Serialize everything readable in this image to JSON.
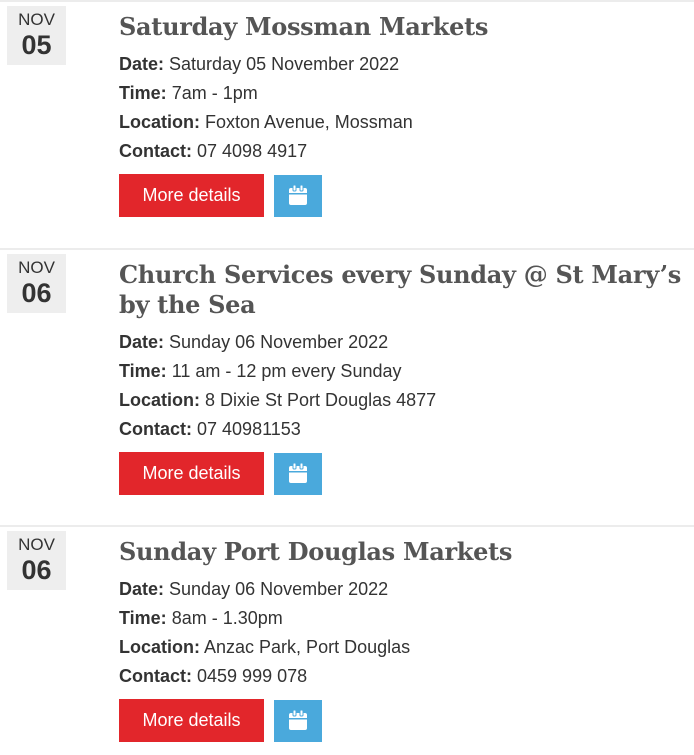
{
  "events": [
    {
      "month": "NOV",
      "day": "05",
      "title": "Saturday Mossman Markets",
      "date_label": "Date:",
      "date": "Saturday 05 November 2022",
      "time_label": "Time:",
      "time": "7am - 1pm",
      "location_label": "Location:",
      "location": "Foxton Avenue, Mossman",
      "contact_label": "Contact:",
      "contact": "07 4098 4917",
      "more_label": "More details",
      "calendar_icon": "calendar-icon"
    },
    {
      "month": "NOV",
      "day": "06",
      "title": "Church Services every Sunday @ St Mary’s by the Sea",
      "date_label": "Date:",
      "date": "Sunday 06 November 2022",
      "time_label": "Time:",
      "time": "11 am - 12 pm every Sunday",
      "location_label": "Location:",
      "location": "8 Dixie St Port Douglas 4877",
      "contact_label": "Contact:",
      "contact": "07 40981153",
      "more_label": "More details",
      "calendar_icon": "calendar-icon"
    },
    {
      "month": "NOV",
      "day": "06",
      "title": "Sunday Port Douglas Markets",
      "date_label": "Date:",
      "date": "Sunday 06 November 2022",
      "time_label": "Time:",
      "time": "8am - 1.30pm",
      "location_label": "Location:",
      "location": "Anzac Park, Port Douglas",
      "contact_label": "Contact:",
      "contact": "0459 999 078",
      "more_label": "More details",
      "calendar_icon": "calendar-icon"
    }
  ],
  "colors": {
    "more_button": "#e2262b",
    "calendar_button": "#4aa9dc",
    "date_badge": "#eeeeee",
    "title": "#555555"
  }
}
